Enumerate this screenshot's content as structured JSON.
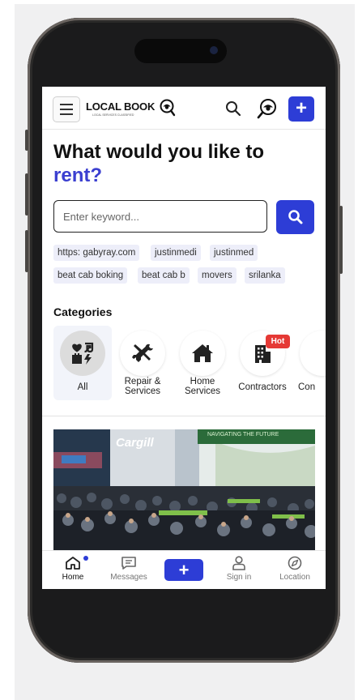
{
  "header": {
    "logo_text": "LOCAL BOOK",
    "logo_subtitle": "LOCAL SERVICES CLASSIFIED",
    "add_label": "+"
  },
  "hero": {
    "headline_line1": "What would you like to",
    "headline_accent": "rent?"
  },
  "search": {
    "placeholder": "Enter keyword...",
    "value": ""
  },
  "chips": [
    "https: gabyray.com",
    "justinmedi",
    "justinmed",
    "beat cab boking",
    "beat cab b",
    "movers",
    "srilanka"
  ],
  "categories": {
    "title": "Categories",
    "items": [
      {
        "label": "All",
        "icon": "all-categories-icon",
        "selected": true
      },
      {
        "label": "Repair & Services",
        "icon": "tools-icon"
      },
      {
        "label": "Home Services",
        "icon": "home-icon"
      },
      {
        "label": "Contractors",
        "icon": "building-icon",
        "badge": "Hot"
      },
      {
        "label": "Con",
        "icon": "partial-category-icon"
      }
    ]
  },
  "banner": {
    "brand": "Cargill",
    "board_text": "NAVIGATING THE FUTURE"
  },
  "bottom_nav": [
    {
      "label": "Home",
      "icon": "home-icon",
      "active": true
    },
    {
      "label": "Messages",
      "icon": "messages-icon"
    },
    {
      "label": "+",
      "icon": "plus-icon"
    },
    {
      "label": "Sign in",
      "icon": "user-icon"
    },
    {
      "label": "Location",
      "icon": "compass-icon"
    }
  ],
  "colors": {
    "accent": "#2d3dd6",
    "headline_accent": "#3b3fd0",
    "chip_bg": "#edeef9",
    "hot_badge": "#e53935"
  }
}
